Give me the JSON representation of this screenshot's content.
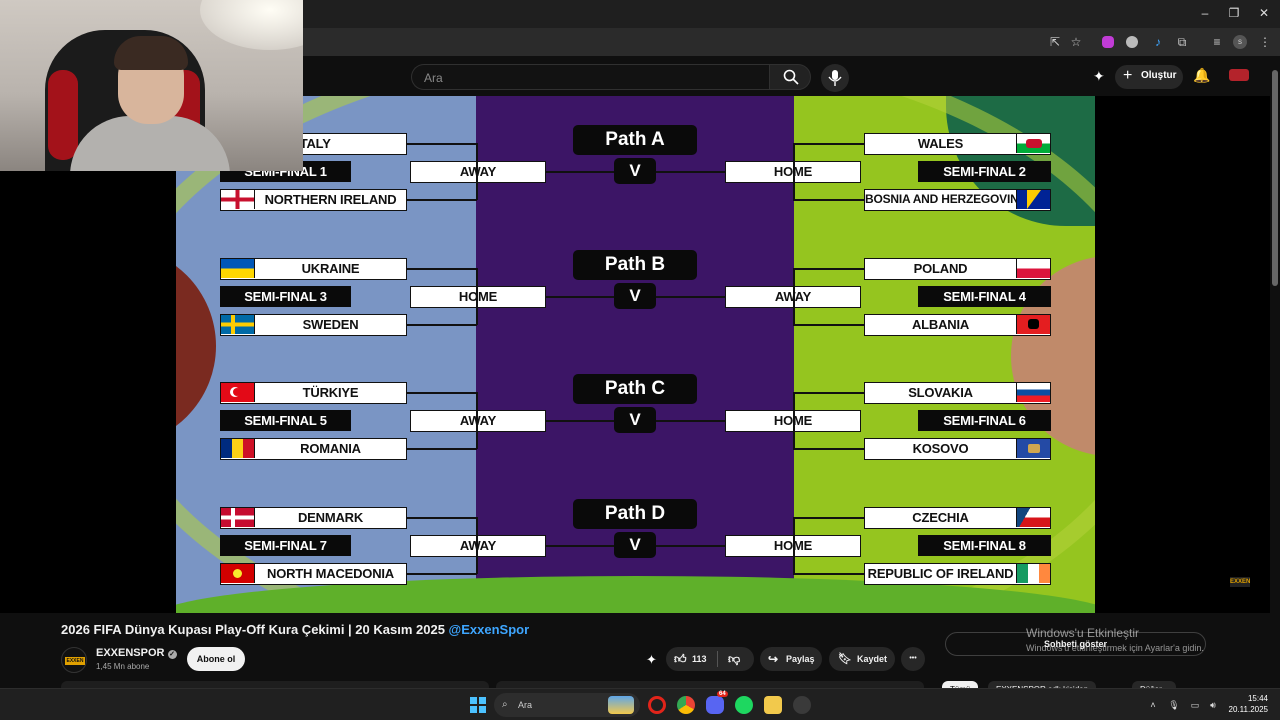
{
  "browser": {
    "window_controls": [
      "–",
      "❐",
      "✕"
    ]
  },
  "youtube": {
    "search_placeholder": "Ara",
    "create_label": "Oluştur"
  },
  "bracket": {
    "paths": [
      {
        "title": "Path A",
        "vs": "V",
        "left": {
          "team_top": "ITALY",
          "semi": "SEMI-FINAL 1",
          "team_bottom": "NORTHERN IRELAND",
          "venue": "AWAY"
        },
        "right": {
          "team_top": "WALES",
          "semi": "SEMI-FINAL 2",
          "team_bottom": "BOSNIA AND HERZEGOVINA",
          "venue": "HOME"
        }
      },
      {
        "title": "Path B",
        "vs": "V",
        "left": {
          "team_top": "UKRAINE",
          "semi": "SEMI-FINAL 3",
          "team_bottom": "SWEDEN",
          "venue": "HOME"
        },
        "right": {
          "team_top": "POLAND",
          "semi": "SEMI-FINAL 4",
          "team_bottom": "ALBANIA",
          "venue": "AWAY"
        }
      },
      {
        "title": "Path C",
        "vs": "V",
        "left": {
          "team_top": "TÜRKIYE",
          "semi": "SEMI-FINAL 5",
          "team_bottom": "ROMANIA",
          "venue": "AWAY"
        },
        "right": {
          "team_top": "SLOVAKIA",
          "semi": "SEMI-FINAL 6",
          "team_bottom": "KOSOVO",
          "venue": "HOME"
        }
      },
      {
        "title": "Path D",
        "vs": "V",
        "left": {
          "team_top": "DENMARK",
          "semi": "SEMI-FINAL 7",
          "team_bottom": "NORTH MACEDONIA",
          "venue": "AWAY"
        },
        "right": {
          "team_top": "CZECHIA",
          "semi": "SEMI-FINAL 8",
          "team_bottom": "REPUBLIC OF IRELAND",
          "venue": "HOME"
        }
      }
    ],
    "watermark": "EXXEN"
  },
  "video": {
    "title": "2026 FIFA Dünya Kupası Play-Off Kura Çekimi | 20 Kasım 2025",
    "title_tag": "@ExxenSpor",
    "channel_name": "EXXENSPOR",
    "channel_avatar_text": "EXXEN",
    "subscribers": "1,45 Mn abone",
    "subscribe_label": "Abone ol",
    "like_count": "113",
    "share_label": "Paylaş",
    "save_label": "Kaydet",
    "more_label": "•••",
    "chat_label": "Sohbeti göster",
    "chips": [
      "Tümü",
      "EXXENSPOR adlı kişiden",
      "Düğer..."
    ]
  },
  "windows_activation": {
    "title": "Windows'u Etkinleştir",
    "subtitle": "Windows'u etkinleştirmek için Ayarlar'a gidin."
  },
  "taskbar": {
    "search_placeholder": "Ara",
    "discord_badge": "64",
    "time": "15:44",
    "date": "20.11.2025"
  },
  "colors": {
    "youtube_bg": "#0f0f0f",
    "bracket_purple": "#3c1566",
    "bracket_green": "#95c51f",
    "bracket_blue": "#7a95c4",
    "link_blue": "#3ea6ff"
  }
}
